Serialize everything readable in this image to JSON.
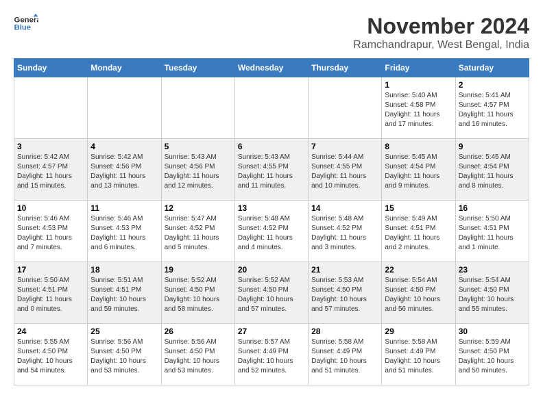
{
  "header": {
    "logo_line1": "General",
    "logo_line2": "Blue",
    "month_year": "November 2024",
    "location": "Ramchandrapur, West Bengal, India"
  },
  "weekdays": [
    "Sunday",
    "Monday",
    "Tuesday",
    "Wednesday",
    "Thursday",
    "Friday",
    "Saturday"
  ],
  "weeks": [
    [
      {
        "day": "",
        "info": ""
      },
      {
        "day": "",
        "info": ""
      },
      {
        "day": "",
        "info": ""
      },
      {
        "day": "",
        "info": ""
      },
      {
        "day": "",
        "info": ""
      },
      {
        "day": "1",
        "info": "Sunrise: 5:40 AM\nSunset: 4:58 PM\nDaylight: 11 hours and 17 minutes."
      },
      {
        "day": "2",
        "info": "Sunrise: 5:41 AM\nSunset: 4:57 PM\nDaylight: 11 hours and 16 minutes."
      }
    ],
    [
      {
        "day": "3",
        "info": "Sunrise: 5:42 AM\nSunset: 4:57 PM\nDaylight: 11 hours and 15 minutes."
      },
      {
        "day": "4",
        "info": "Sunrise: 5:42 AM\nSunset: 4:56 PM\nDaylight: 11 hours and 13 minutes."
      },
      {
        "day": "5",
        "info": "Sunrise: 5:43 AM\nSunset: 4:56 PM\nDaylight: 11 hours and 12 minutes."
      },
      {
        "day": "6",
        "info": "Sunrise: 5:43 AM\nSunset: 4:55 PM\nDaylight: 11 hours and 11 minutes."
      },
      {
        "day": "7",
        "info": "Sunrise: 5:44 AM\nSunset: 4:55 PM\nDaylight: 11 hours and 10 minutes."
      },
      {
        "day": "8",
        "info": "Sunrise: 5:45 AM\nSunset: 4:54 PM\nDaylight: 11 hours and 9 minutes."
      },
      {
        "day": "9",
        "info": "Sunrise: 5:45 AM\nSunset: 4:54 PM\nDaylight: 11 hours and 8 minutes."
      }
    ],
    [
      {
        "day": "10",
        "info": "Sunrise: 5:46 AM\nSunset: 4:53 PM\nDaylight: 11 hours and 7 minutes."
      },
      {
        "day": "11",
        "info": "Sunrise: 5:46 AM\nSunset: 4:53 PM\nDaylight: 11 hours and 6 minutes."
      },
      {
        "day": "12",
        "info": "Sunrise: 5:47 AM\nSunset: 4:52 PM\nDaylight: 11 hours and 5 minutes."
      },
      {
        "day": "13",
        "info": "Sunrise: 5:48 AM\nSunset: 4:52 PM\nDaylight: 11 hours and 4 minutes."
      },
      {
        "day": "14",
        "info": "Sunrise: 5:48 AM\nSunset: 4:52 PM\nDaylight: 11 hours and 3 minutes."
      },
      {
        "day": "15",
        "info": "Sunrise: 5:49 AM\nSunset: 4:51 PM\nDaylight: 11 hours and 2 minutes."
      },
      {
        "day": "16",
        "info": "Sunrise: 5:50 AM\nSunset: 4:51 PM\nDaylight: 11 hours and 1 minute."
      }
    ],
    [
      {
        "day": "17",
        "info": "Sunrise: 5:50 AM\nSunset: 4:51 PM\nDaylight: 11 hours and 0 minutes."
      },
      {
        "day": "18",
        "info": "Sunrise: 5:51 AM\nSunset: 4:51 PM\nDaylight: 10 hours and 59 minutes."
      },
      {
        "day": "19",
        "info": "Sunrise: 5:52 AM\nSunset: 4:50 PM\nDaylight: 10 hours and 58 minutes."
      },
      {
        "day": "20",
        "info": "Sunrise: 5:52 AM\nSunset: 4:50 PM\nDaylight: 10 hours and 57 minutes."
      },
      {
        "day": "21",
        "info": "Sunrise: 5:53 AM\nSunset: 4:50 PM\nDaylight: 10 hours and 57 minutes."
      },
      {
        "day": "22",
        "info": "Sunrise: 5:54 AM\nSunset: 4:50 PM\nDaylight: 10 hours and 56 minutes."
      },
      {
        "day": "23",
        "info": "Sunrise: 5:54 AM\nSunset: 4:50 PM\nDaylight: 10 hours and 55 minutes."
      }
    ],
    [
      {
        "day": "24",
        "info": "Sunrise: 5:55 AM\nSunset: 4:50 PM\nDaylight: 10 hours and 54 minutes."
      },
      {
        "day": "25",
        "info": "Sunrise: 5:56 AM\nSunset: 4:50 PM\nDaylight: 10 hours and 53 minutes."
      },
      {
        "day": "26",
        "info": "Sunrise: 5:56 AM\nSunset: 4:50 PM\nDaylight: 10 hours and 53 minutes."
      },
      {
        "day": "27",
        "info": "Sunrise: 5:57 AM\nSunset: 4:49 PM\nDaylight: 10 hours and 52 minutes."
      },
      {
        "day": "28",
        "info": "Sunrise: 5:58 AM\nSunset: 4:49 PM\nDaylight: 10 hours and 51 minutes."
      },
      {
        "day": "29",
        "info": "Sunrise: 5:58 AM\nSunset: 4:49 PM\nDaylight: 10 hours and 51 minutes."
      },
      {
        "day": "30",
        "info": "Sunrise: 5:59 AM\nSunset: 4:50 PM\nDaylight: 10 hours and 50 minutes."
      }
    ]
  ]
}
